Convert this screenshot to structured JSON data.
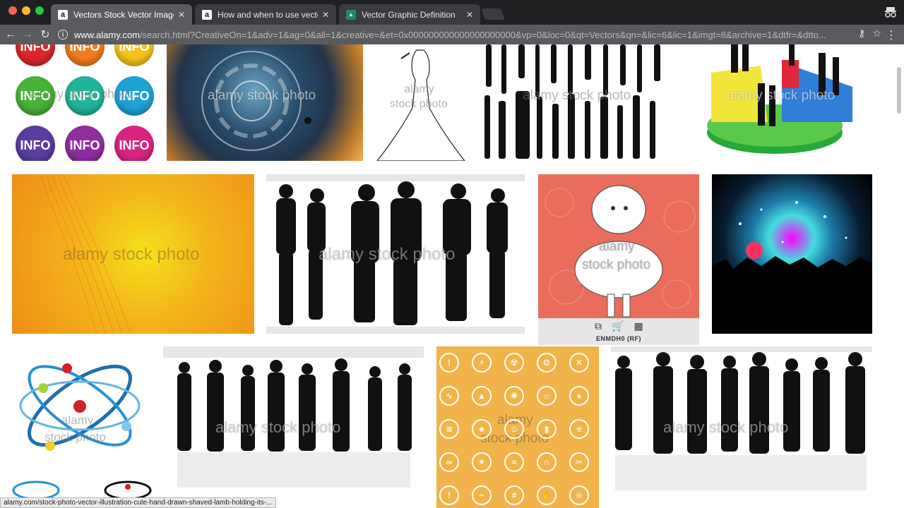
{
  "browser": {
    "tabs": [
      {
        "title": "Vectors Stock Vector Images -",
        "favicon": "a",
        "active": true
      },
      {
        "title": "How and when to use vectors",
        "favicon": "a",
        "active": false
      },
      {
        "title": "Vector Graphic Definition",
        "favicon": "▲",
        "active": false
      }
    ],
    "url_host": "www.alamy.com",
    "url_path": "/search.html?CreativeOn=1&adv=1&ag=0&all=1&creative=&et=0x000000000000000000000&vp=0&loc=0&qt=Vectors&qn=&lic=6&lic=1&imgt=8&archive=1&dtfr=&dtto..."
  },
  "results": {
    "watermark": "alamy stock photo",
    "watermark_split_1": "alamy",
    "watermark_split_2": "stock photo",
    "info_badge_label": "INFO",
    "hover_item_code": "ENMDH0  (RF)"
  },
  "status_bar": "alamy.com/stock-photo-vector-illustration-cute-hand-drawn-shaved-lamb-holding-its-...",
  "colors": {
    "tab_strip": "#1f2022",
    "toolbar": "#5a5b5e",
    "orange_tile": "#f2a11c",
    "salmon_tile": "#ea6d5c",
    "icon_tile": "#f2b44a"
  }
}
